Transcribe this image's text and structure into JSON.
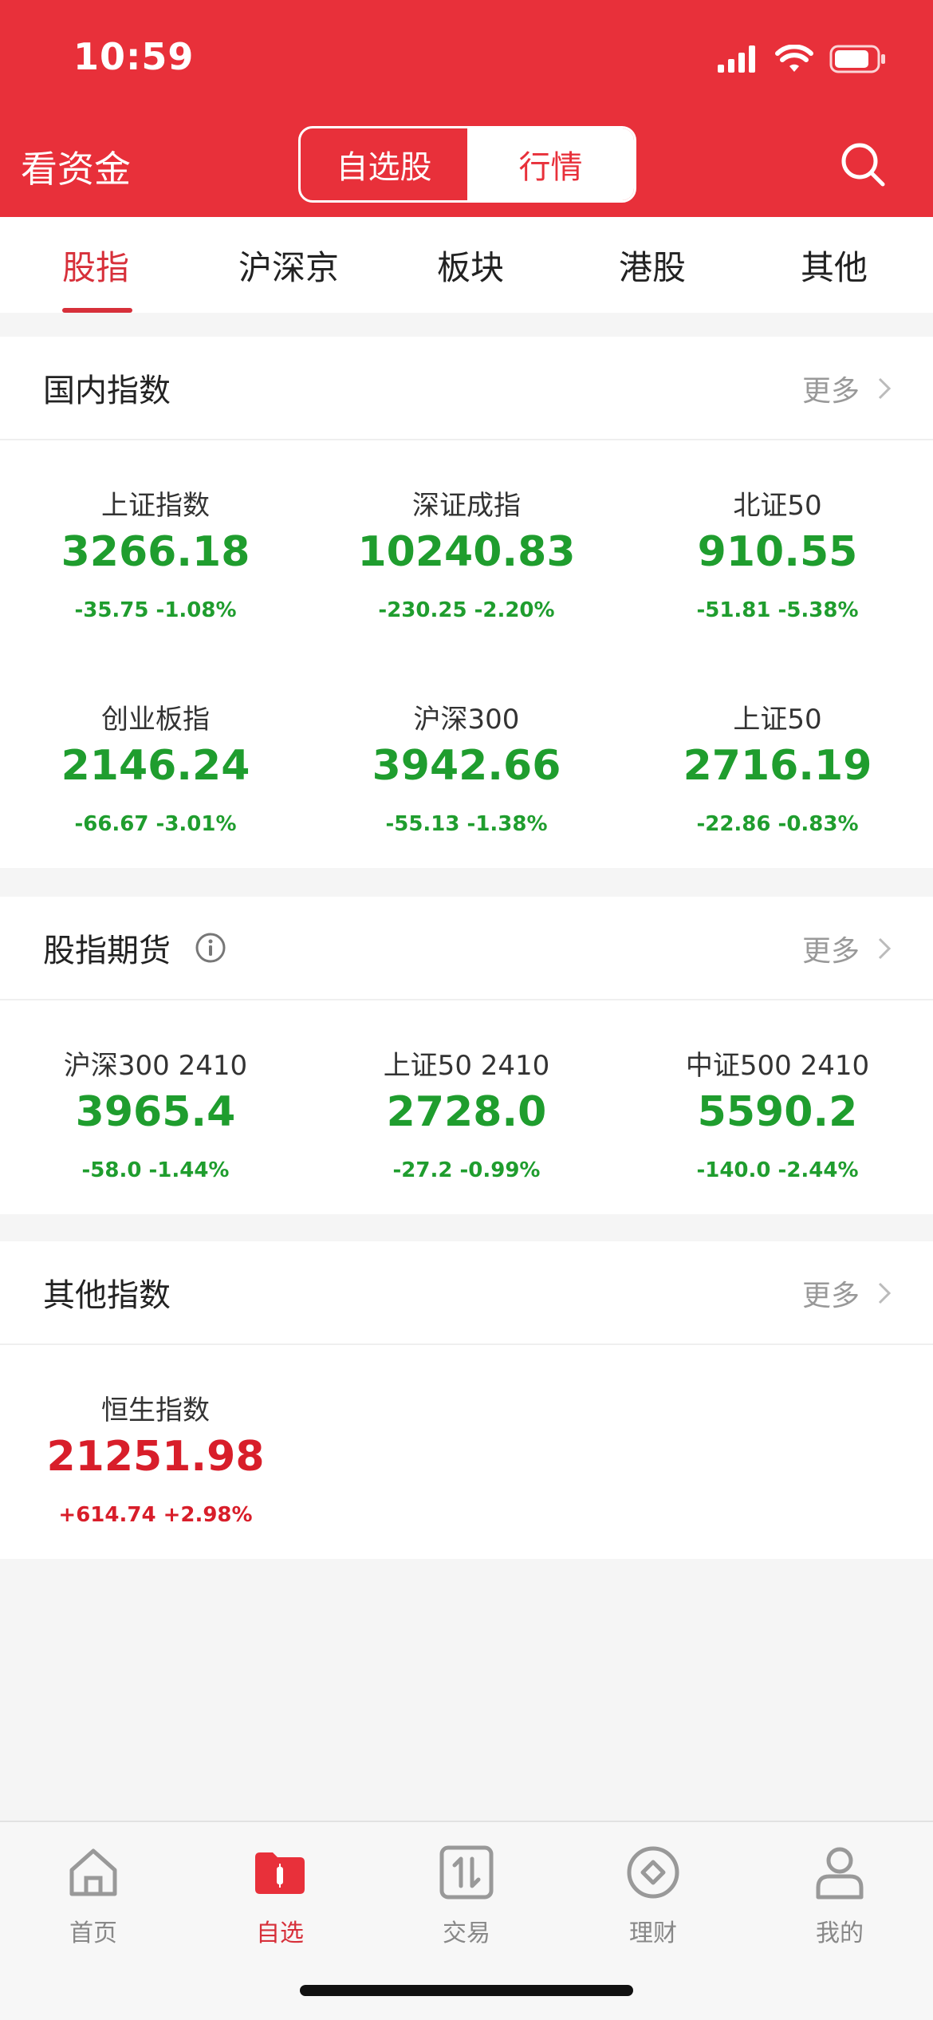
{
  "status": {
    "time": "10:59"
  },
  "header": {
    "left_title": "看资金",
    "segments": [
      "自选股",
      "行情"
    ],
    "active_segment": "行情",
    "accent_color": "#e8303a"
  },
  "tabs": [
    "股指",
    "沪深京",
    "板块",
    "港股",
    "其他"
  ],
  "domestic": {
    "title": "国内指数",
    "more": "更多",
    "items": [
      {
        "name": "上证指数",
        "price": "3266.18",
        "change": "-35.75  -1.08%"
      },
      {
        "name": "深证成指",
        "price": "10240.83",
        "change": "-230.25  -2.20%"
      },
      {
        "name": "北证50",
        "price": "910.55",
        "change": "-51.81  -5.38%"
      },
      {
        "name": "创业板指",
        "price": "2146.24",
        "change": "-66.67  -3.01%"
      },
      {
        "name": "沪深300",
        "price": "3942.66",
        "change": "-55.13  -1.38%"
      },
      {
        "name": "上证50",
        "price": "2716.19",
        "change": "-22.86  -0.83%"
      }
    ]
  },
  "futures": {
    "title": "股指期货",
    "more": "更多",
    "items": [
      {
        "name": "沪深300 2410",
        "price": "3965.4",
        "change": "-58.0  -1.44%"
      },
      {
        "name": "上证50 2410",
        "price": "2728.0",
        "change": "-27.2  -0.99%"
      },
      {
        "name": "中证500 2410",
        "price": "5590.2",
        "change": "-140.0  -2.44%"
      }
    ]
  },
  "others": {
    "title": "其他指数",
    "more": "更多",
    "items": [
      {
        "name": "恒生指数",
        "price": "21251.98",
        "change": "+614.74  +2.98%"
      }
    ]
  },
  "tabbar": [
    "首页",
    "自选",
    "交易",
    "理财",
    "我的"
  ],
  "colors": {
    "down": "#1f9d2e",
    "up": "#d81e2a"
  }
}
